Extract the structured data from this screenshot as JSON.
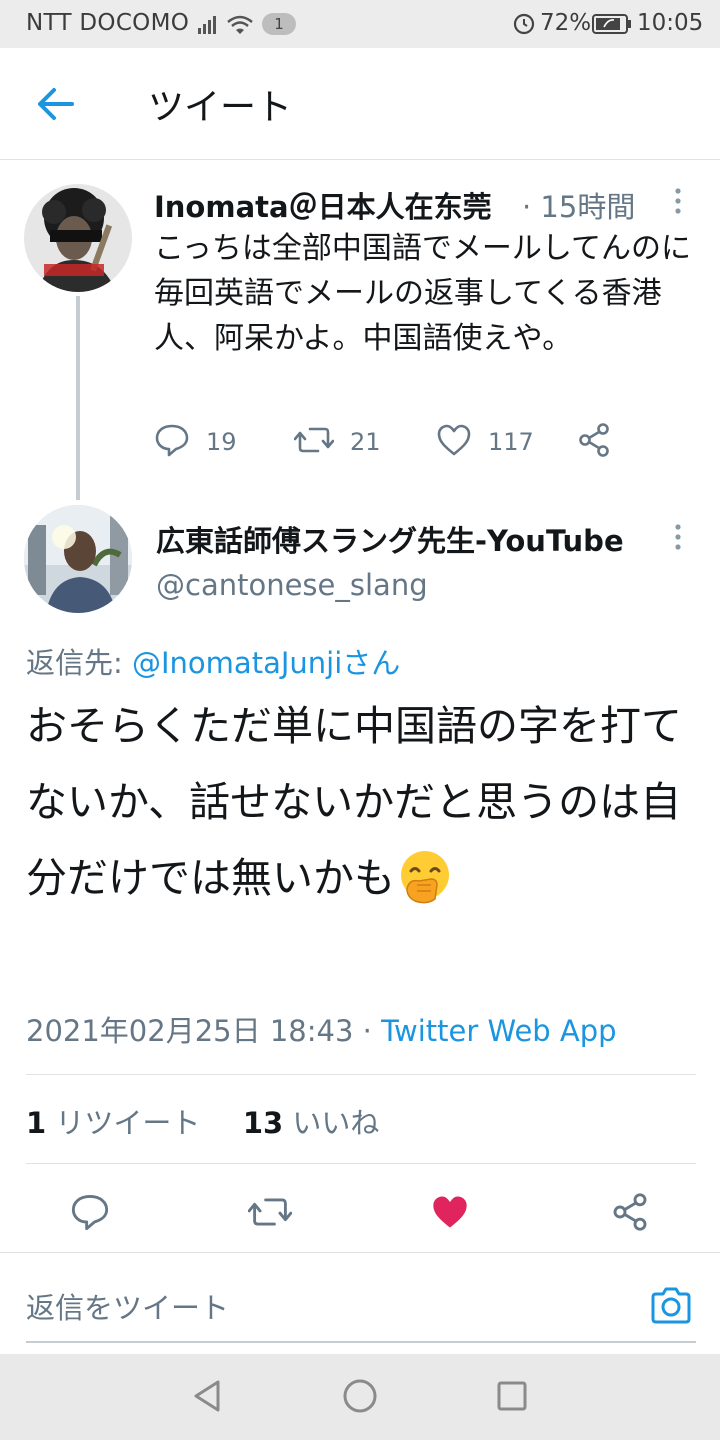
{
  "status_bar": {
    "carrier": "NTT DOCOMO",
    "notification_count": "1",
    "battery": "72%",
    "time": "10:05"
  },
  "header": {
    "title": "ツイート"
  },
  "tweet1": {
    "name": "Inomata＠日本人在东莞",
    "time": "· 15時間",
    "text": "こっちは全部中国語でメールしてんのに毎回英語でメールの返事してくる香港人、阿呆かよ。中国語使えや。",
    "replies": "19",
    "retweets": "21",
    "likes": "117"
  },
  "tweet2": {
    "name": "広東話師傅スラング先生-YouTube",
    "handle": "@cantonese_slang",
    "reply_prefix": "返信先: ",
    "reply_mention": "@InomataJunjiさん",
    "text": "おそらくただ単に中国語の字を打てないか、話せないかだと思うのは自分だけでは無いかも",
    "datetime": "2021年02月25日 18:43 · ",
    "via": "Twitter Web App",
    "retweet_count": "1",
    "retweet_label": " リツイート",
    "like_count": "13",
    "like_label": " いいね"
  },
  "composer": {
    "placeholder": "返信をツイート"
  },
  "colors": {
    "accent": "#1b95e0",
    "like": "#e0245e",
    "muted": "#657786"
  }
}
